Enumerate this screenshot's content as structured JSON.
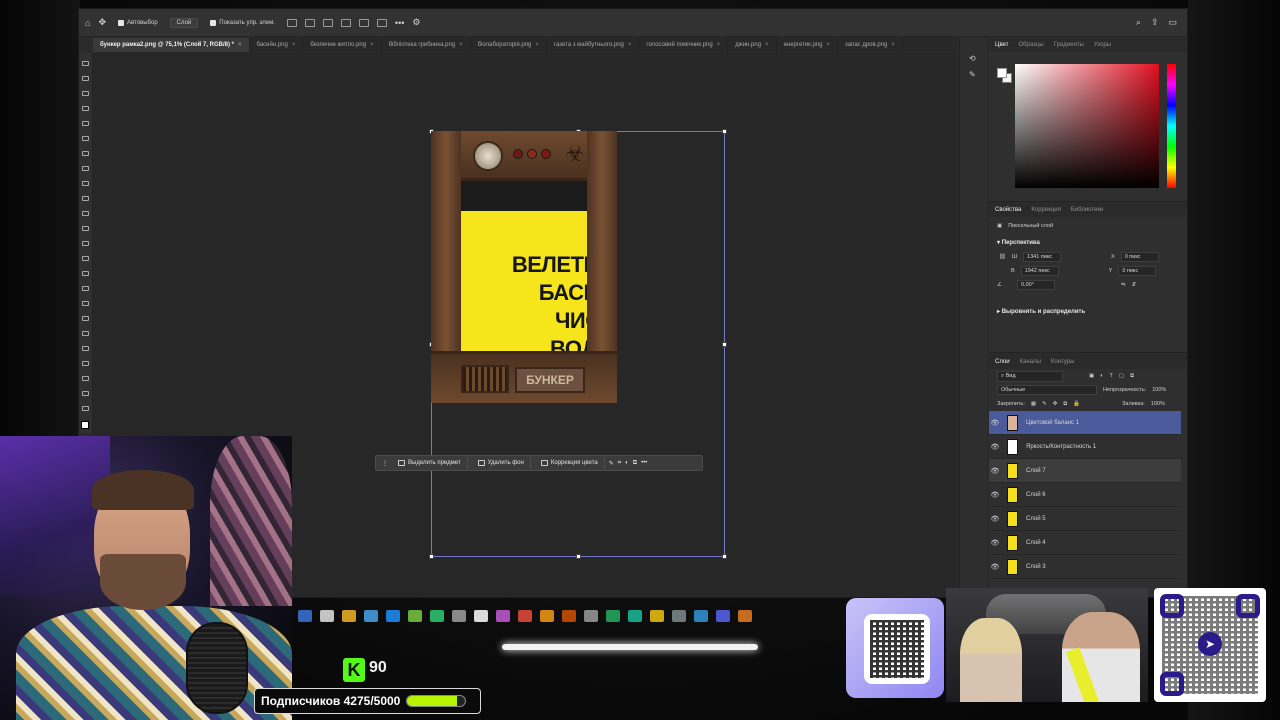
{
  "optbar": {
    "autoselect": "Автовыбор",
    "layer_mode": "Слой",
    "show_transform": "Показать упр. элем."
  },
  "tabs": [
    {
      "label": "бункер рамка2.png @ 75,1% (Слой 7, RGB/8) *",
      "active": true
    },
    {
      "label": "басейн.png"
    },
    {
      "label": "безпечне житло.png"
    },
    {
      "label": "бібліотека грибника.png"
    },
    {
      "label": "біолабораторія.png"
    },
    {
      "label": "газета з майбутнього.png"
    },
    {
      "label": "голосовий помічник.png"
    },
    {
      "label": "джин.png"
    },
    {
      "label": "енергетик.png"
    },
    {
      "label": "запас дров.png"
    }
  ],
  "document": {
    "sign_lines": [
      "ВЕЛЕТЕН",
      "БАСЕЙ",
      "ЧИСТ",
      "ВОДО"
    ],
    "plate": "БУНКЕР"
  },
  "context_bar": {
    "select_subject": "Выделить предмет",
    "remove_bg": "Удалить фон",
    "color_correction": "Коррекция цвета"
  },
  "color_panel": {
    "tabs": [
      "Цвет",
      "Образцы",
      "Градиенты",
      "Узоры"
    ]
  },
  "properties_panel": {
    "tabs": [
      "Свойства",
      "Коррекция",
      "Библиотеки"
    ],
    "layer_type": "Пиксельный слой",
    "section_perspective": "Перспектива",
    "w_label": "Ш",
    "w_value": "1341 пикс",
    "h_label": "В",
    "h_value": "1942 пикс",
    "x_label": "X",
    "x_value": "0 пикс",
    "y_label": "Y",
    "y_value": "0 пикс",
    "angle": "0,00°",
    "section_align": "Выровнять и распределить"
  },
  "layers_panel": {
    "tabs": [
      "Слои",
      "Каналы",
      "Контуры"
    ],
    "filter": "Вид",
    "blend_mode": "Обычные",
    "opacity_label": "Непрозрачность:",
    "opacity_value": "100%",
    "lock_label": "Закрепить:",
    "fill_label": "Заливка:",
    "fill_value": "100%",
    "layers": [
      {
        "name": "Цветовой баланс 1",
        "selected": true
      },
      {
        "name": "Яркость/Контрастность 1"
      },
      {
        "name": "Слой 7",
        "current": true
      },
      {
        "name": "Слой 6"
      },
      {
        "name": "Слой 5"
      },
      {
        "name": "Слой 4"
      },
      {
        "name": "Слой 3"
      }
    ]
  },
  "stream": {
    "kick_count": "90",
    "kick_letter": "K",
    "subs_text": "Подписчиков 4275/5000",
    "subs_progress": 0.855
  },
  "colors": {
    "accent_green": "#53fc18",
    "progress": "#b6f400",
    "selected_layer": "#4a5a9a"
  }
}
